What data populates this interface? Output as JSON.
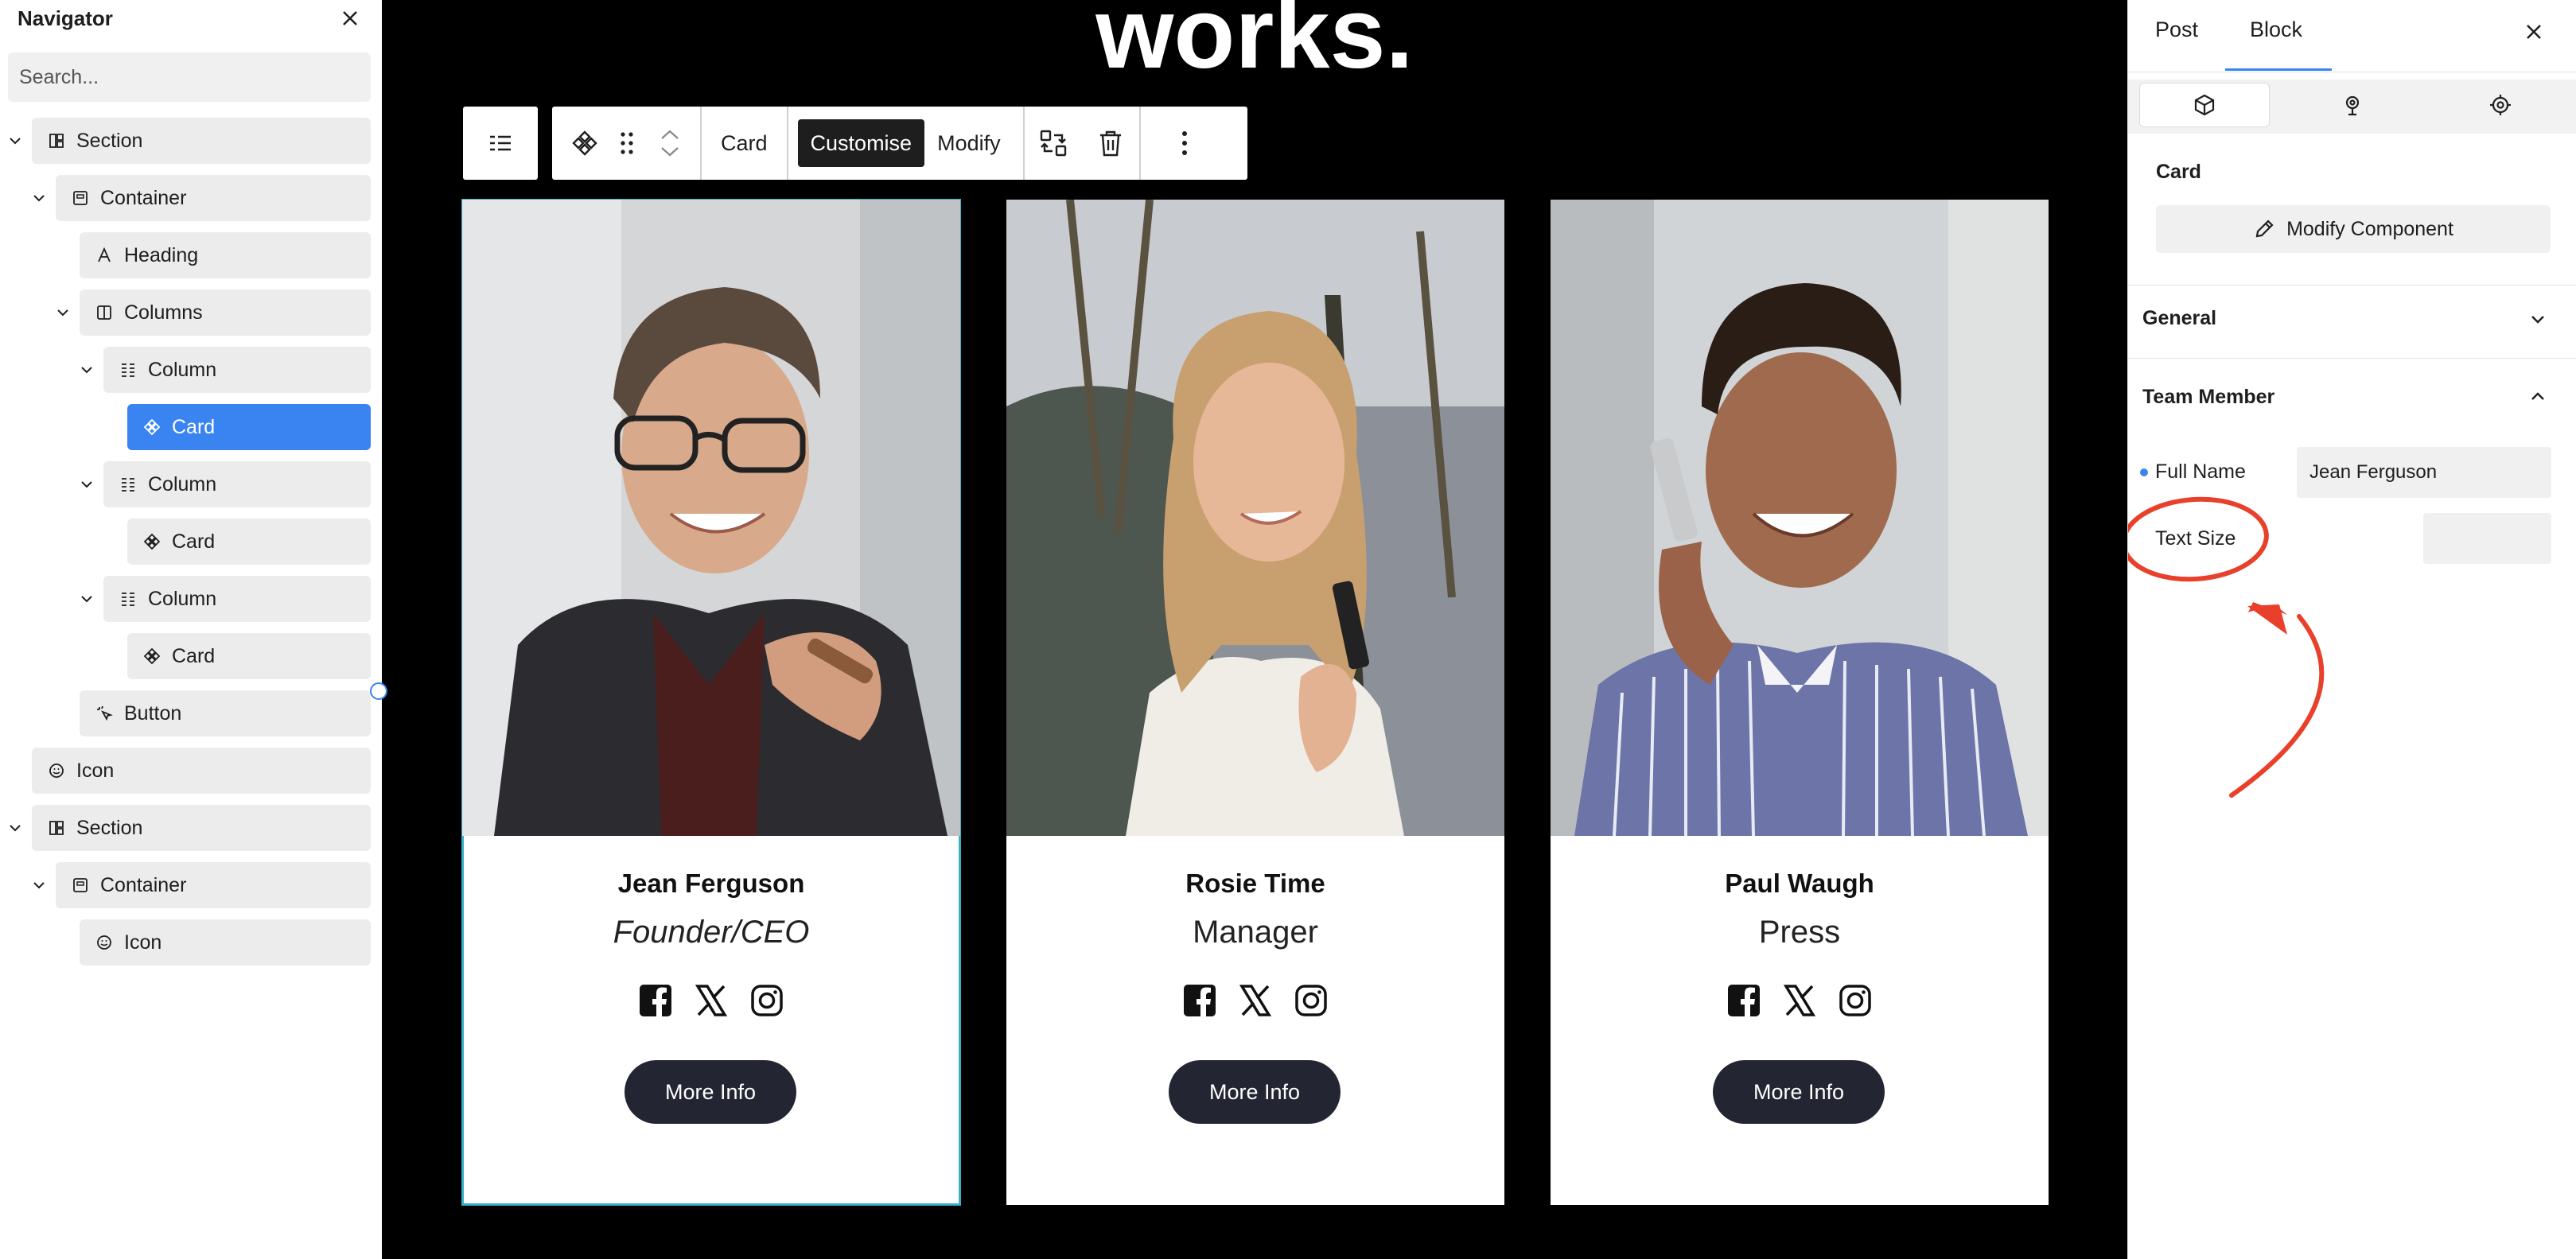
{
  "navigator": {
    "title": "Navigator",
    "search_placeholder": "Search...",
    "tree": [
      {
        "label": "Section",
        "icon": "section-icon",
        "expanded": true
      },
      {
        "label": "Container",
        "icon": "container-icon",
        "expanded": true
      },
      {
        "label": "Heading",
        "icon": "heading-icon"
      },
      {
        "label": "Columns",
        "icon": "columns-icon",
        "expanded": true
      },
      {
        "label": "Column",
        "icon": "column-icon",
        "expanded": true
      },
      {
        "label": "Card",
        "icon": "component-icon",
        "selected": true
      },
      {
        "label": "Column",
        "icon": "column-icon",
        "expanded": true
      },
      {
        "label": "Card",
        "icon": "component-icon"
      },
      {
        "label": "Column",
        "icon": "column-icon",
        "expanded": true
      },
      {
        "label": "Card",
        "icon": "component-icon"
      },
      {
        "label": "Button",
        "icon": "button-icon"
      },
      {
        "label": "Icon",
        "icon": "smiley-icon"
      },
      {
        "label": "Section",
        "icon": "section-icon",
        "expanded": true
      },
      {
        "label": "Container",
        "icon": "container-icon",
        "expanded": true
      },
      {
        "label": "Icon",
        "icon": "smiley-icon"
      }
    ]
  },
  "canvas": {
    "heading": "works.",
    "toolbar": {
      "block_label": "Card",
      "customise_label": "Customise",
      "modify_label": "Modify"
    },
    "cards": [
      {
        "name": "Jean Ferguson",
        "role": "Founder/CEO",
        "button": "More Info"
      },
      {
        "name": "Rosie Time",
        "role": "Manager",
        "button": "More Info"
      },
      {
        "name": "Paul Waugh",
        "role": "Press",
        "button": "More Info"
      }
    ],
    "colors": {
      "background": "#000000",
      "button": "#232533",
      "selection": "#3ab0c8"
    }
  },
  "panel": {
    "tabs": [
      "Post",
      "Block"
    ],
    "active_tab": "Block",
    "component_title": "Card",
    "modify_component_label": "Modify Component",
    "general_label": "General",
    "team_member_label": "Team Member",
    "full_name_label": "Full Name",
    "full_name_value": "Jean Ferguson",
    "text_size_label": "Text Size",
    "text_size_value": "",
    "accent": "#3a84f2",
    "annotation_color": "#e8402a"
  }
}
